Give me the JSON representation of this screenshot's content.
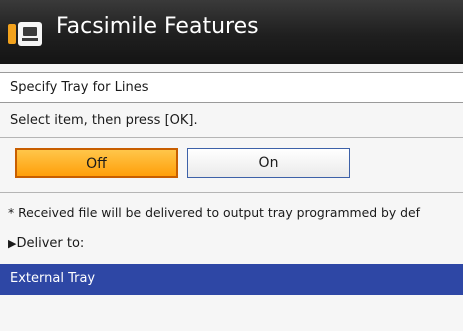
{
  "header": {
    "title": "Facsimile Features",
    "icon": "fax-machine-icon"
  },
  "subheader": {
    "label": "Specify Tray for Lines"
  },
  "instruction": "Select item, then press [OK].",
  "options": {
    "off_label": "Off",
    "on_label": "On",
    "selected": "Off"
  },
  "note": "* Received file will be delivered to output tray programmed by def",
  "deliver": {
    "arrow": "▶",
    "label": "Deliver to:"
  },
  "destination": {
    "selected_value": "External Tray"
  },
  "colors": {
    "selected_option": "#ffa321",
    "selected_row": "#2e47a5",
    "title_bar": "#1f1f1f"
  }
}
